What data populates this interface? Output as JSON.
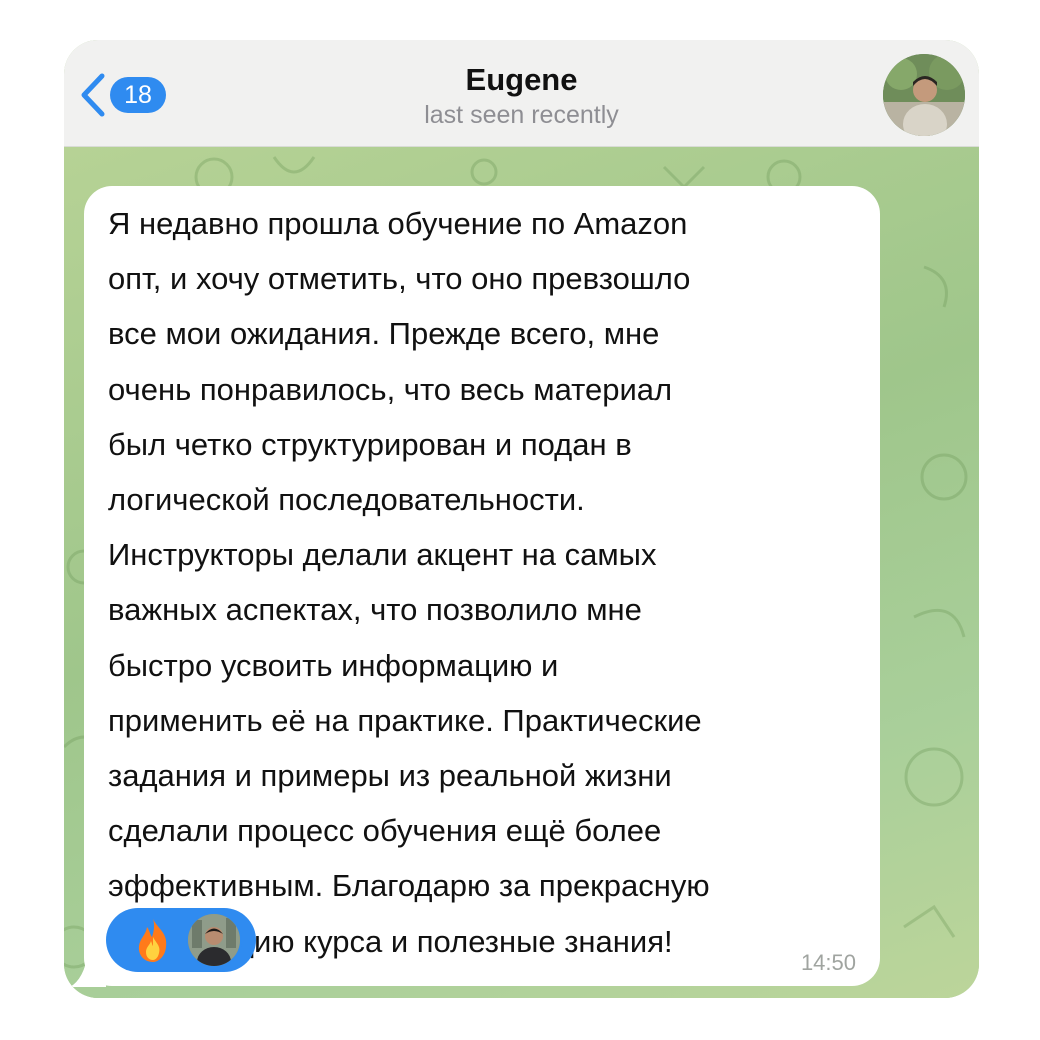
{
  "header": {
    "back_count": "18",
    "title": "Eugene",
    "subtitle": "last seen recently"
  },
  "message": {
    "text": "Я недавно прошла обучение по Amazon\nопт, и хочу отметить, что оно превзошло\nвсе мои ожидания. Прежде всего, мне\nочень понравилось, что весь материал\nбыл четко структурирован и подан в\nлогической последовательности.\nИнструкторы делали акцент на самых\nважных аспектах, что позволило мне\nбыстро усвоить информацию и\nприменить её на практике. Практические\nзадания и примеры из реальной жизни\nсделали процесс обучения ещё более\nэффективным. Благодарю за прекрасную\nорганизацию курса и полезные знания!",
    "time": "14:50",
    "reactions": [
      {
        "icon": "fire-icon",
        "count_avatar": "reactor-avatar"
      }
    ]
  },
  "colors": {
    "accent": "#2f8bf0",
    "header_bg": "#f1f1f0",
    "chat_bg": "#a9cf9a",
    "bubble_bg": "#ffffff"
  }
}
